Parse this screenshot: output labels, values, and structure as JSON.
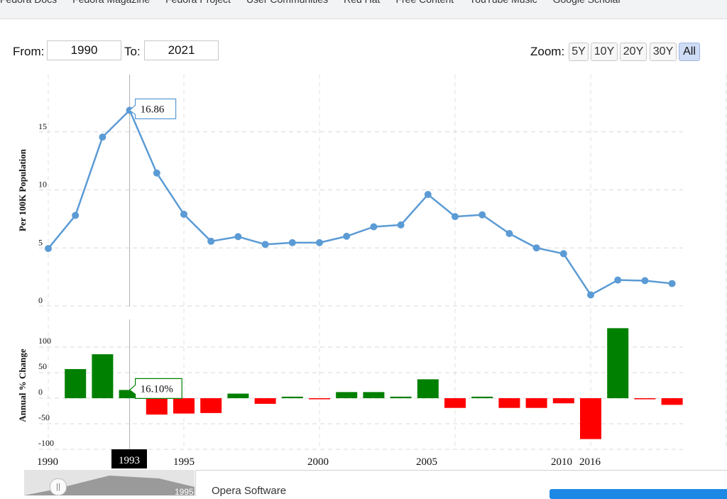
{
  "bookmarks": [
    "Fedora Docs",
    "Fedora Magazine",
    "Fedora Project",
    "User Communities",
    "Red Hat",
    "Free Content",
    "YouTube Music",
    "Google Scholar"
  ],
  "range": {
    "from_label": "From:",
    "from_value": "1990",
    "to_label": "To:",
    "to_value": "2021"
  },
  "zoom": {
    "label": "Zoom:",
    "buttons": [
      "5Y",
      "10Y",
      "20Y",
      "30Y",
      "All"
    ],
    "active": "All"
  },
  "colors": {
    "line": "#5b9bd5",
    "positive": "#008000",
    "negative": "#ff0000"
  },
  "chart_data": [
    {
      "type": "line",
      "x": [
        1990,
        1991,
        1992,
        1993,
        1994,
        1995,
        1996,
        1997,
        1998,
        1999,
        2000,
        2001,
        2002,
        2003,
        2004,
        2005,
        2006,
        2007,
        2008,
        2009,
        2010,
        2011,
        2012,
        2013,
        2014
      ],
      "y": [
        4.95,
        7.8,
        14.55,
        16.86,
        11.45,
        7.9,
        5.57,
        5.97,
        5.3,
        5.45,
        5.45,
        6.0,
        6.82,
        6.98,
        9.6,
        7.7,
        7.85,
        6.24,
        5.0,
        4.5,
        0.95,
        2.23,
        2.18,
        1.93
      ],
      "ylabel": "Per 100K Population",
      "yticks": [
        0,
        5,
        10,
        15
      ],
      "ylim": [
        0,
        20
      ],
      "tooltip": {
        "x": 1993,
        "text": "16.86"
      }
    },
    {
      "type": "bar",
      "x": [
        1991,
        1992,
        1993,
        1994,
        1995,
        1996,
        1997,
        1998,
        1999,
        2000,
        2001,
        2002,
        2003,
        2004,
        2005,
        2006,
        2007,
        2008,
        2009,
        2010,
        2011,
        2012,
        2013,
        2014
      ],
      "values": [
        57,
        86,
        16.1,
        -32,
        -30,
        -29,
        9,
        -11,
        3,
        -1,
        12,
        12,
        3,
        37,
        -19,
        3,
        -19,
        -19,
        -10,
        -80,
        137,
        -2,
        -13
      ],
      "ylabel": "Annual % Change",
      "yticks": [
        -100,
        -50,
        0,
        50,
        100
      ],
      "ylim": [
        -100,
        100
      ],
      "tooltip": {
        "x": 1993,
        "text": "16.10%"
      }
    }
  ],
  "xaxis": {
    "labels": [
      "1990",
      "1993",
      "1995",
      "2000",
      "2005",
      "2010",
      "2016"
    ],
    "highlight": "1993"
  },
  "navigator": {
    "label": "1995",
    "handle": "||"
  },
  "popup": {
    "title": "Opera Software"
  }
}
